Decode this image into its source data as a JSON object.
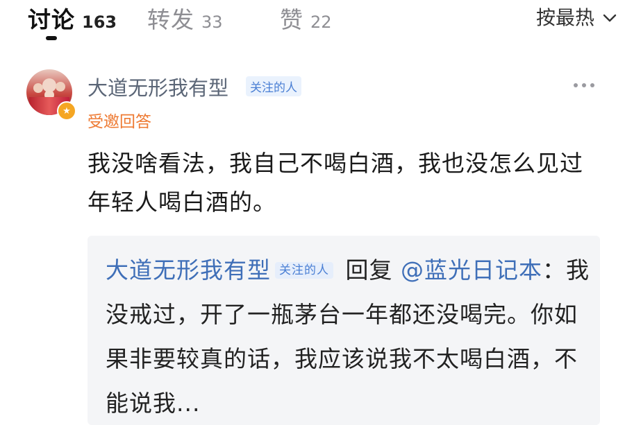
{
  "tabs": [
    {
      "label": "讨论",
      "count": "163",
      "active": true
    },
    {
      "label": "转发",
      "count": "33",
      "active": false
    },
    {
      "label": "赞",
      "count": "22",
      "active": false
    }
  ],
  "sort": {
    "label": "按最热",
    "icon": "chevron-down-icon"
  },
  "comment": {
    "username": "大道无形我有型",
    "follow_tag": "关注的人",
    "invited_label": "受邀回答",
    "more_icon": "more-dots-icon",
    "badge_icon": "vip-star-icon",
    "text": "我没啥看法，我自己不喝白酒，我也没怎么见过年轻人喝白酒的。",
    "reply": {
      "username": "大道无形我有型",
      "follow_tag": "关注的人",
      "reply_word": "回复",
      "mention": "@蓝光日记本",
      "text": "：我没戒过，开了一瓶茅台一年都还没喝完。你如果非要较真的话，我应该说我不太喝白酒，不能说我..."
    }
  },
  "colors": {
    "accent_blue": "#3f6fb8",
    "invited_orange": "#ee7b34",
    "username_gray": "#5b6677",
    "inactive_tab": "#8e8e93",
    "quote_bg": "#f4f5f7"
  }
}
